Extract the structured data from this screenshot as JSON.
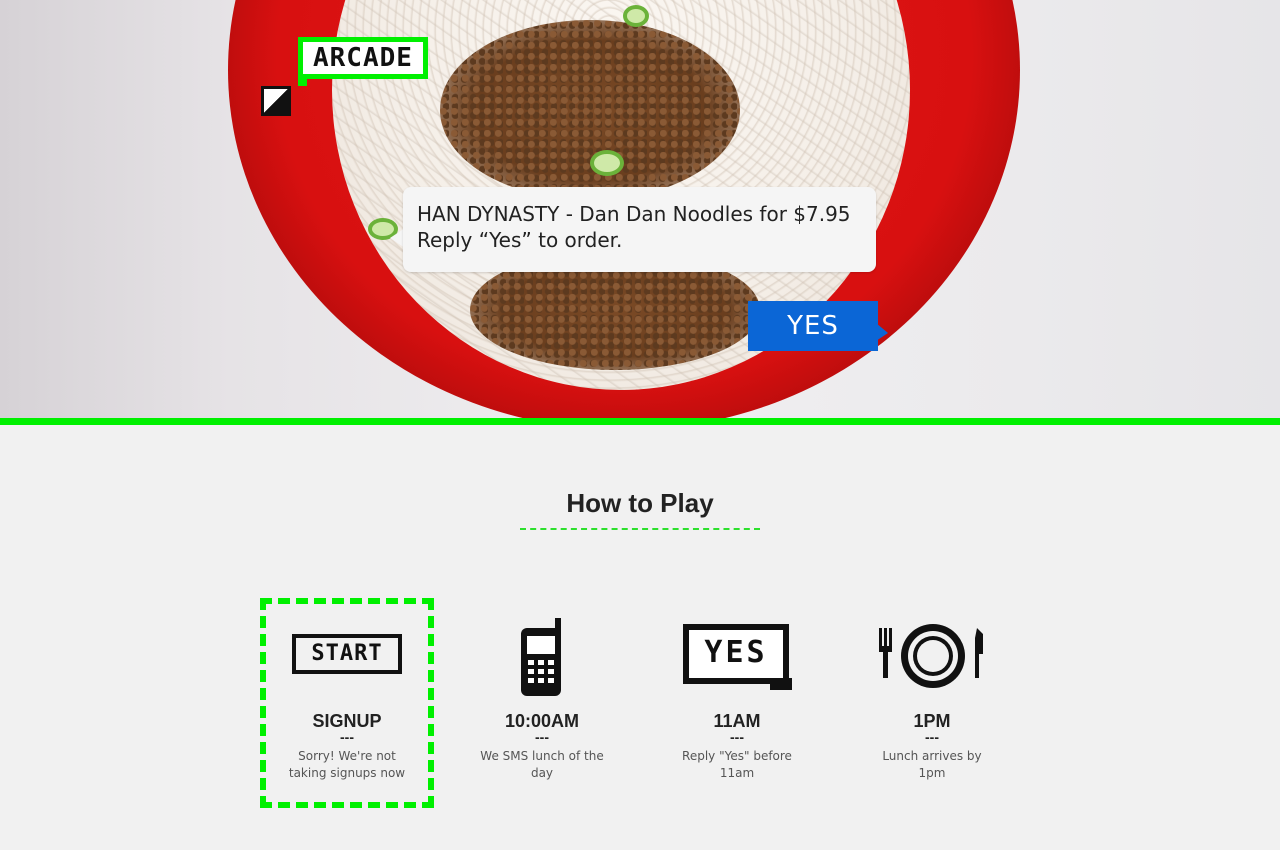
{
  "hero": {
    "logo_text": "ARCADE",
    "message_line1": "HAN DYNASTY - Dan Dan Noodles for $7.95",
    "message_line2": "Reply “Yes” to order.",
    "yes_button": "YES"
  },
  "how_to_play": {
    "title": "How to Play",
    "steps": [
      {
        "icon": "start-icon",
        "icon_text": "START",
        "label": "SIGNUP",
        "dash": "---",
        "description": "Sorry! We're not taking signups now"
      },
      {
        "icon": "phone-icon",
        "label": "10:00AM",
        "dash": "---",
        "description": "We SMS lunch of the day"
      },
      {
        "icon": "yes-reply-icon",
        "icon_text": "YES",
        "label": "11AM",
        "dash": "---",
        "description": "Reply \"Yes\" before 11am"
      },
      {
        "icon": "plate-utensils-icon",
        "label": "1PM",
        "dash": "---",
        "description": "Lunch arrives by 1pm"
      }
    ]
  },
  "colors": {
    "accent_green": "#00f000",
    "yes_blue": "#0b66d6",
    "bowl_red": "#d81010"
  }
}
